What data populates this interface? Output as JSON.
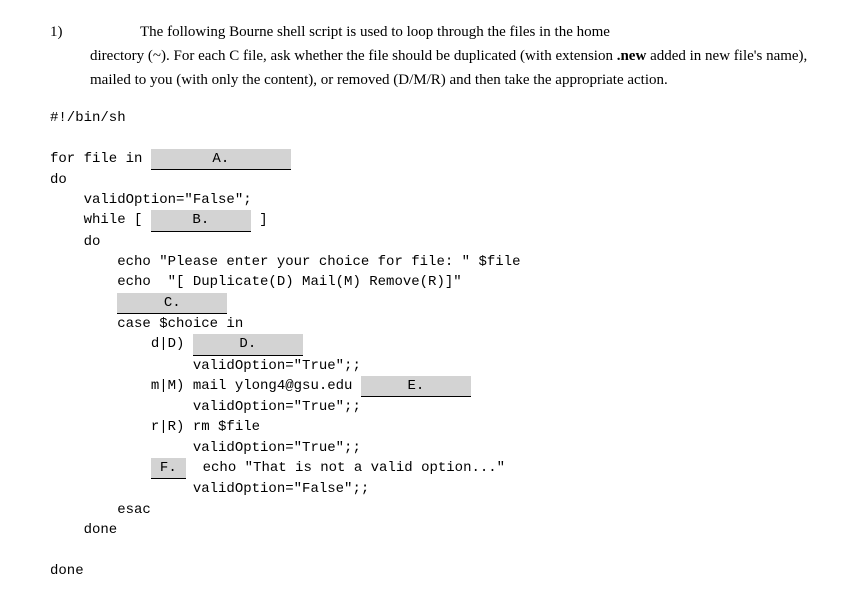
{
  "question": {
    "number": "1)",
    "intro_first": "The following Bourne shell script is used to loop through the files in the home",
    "intro_rest": "directory (~). For each C file, ask whether the file should be duplicated (with extension ",
    "intro_ext": ".new",
    "intro_rest2": " added in new file's name), mailed to you (with only the content), or removed (D/M/R) and then take the appropriate action."
  },
  "code": {
    "shebang": "#!/bin/sh",
    "for_line_pre": "for file in ",
    "do1": "do",
    "valid_opt": "    validOption=\"False\";",
    "while_pre": "    while [ ",
    "while_post": " ]",
    "do2": "    do",
    "echo1": "        echo \"Please enter your choice for file: \" $file",
    "echo2": "        echo  \"[ Duplicate(D) Mail(M) Remove(R)]\"",
    "blank_c_indent": "        ",
    "case_line": "        case $choice in",
    "case_d_pre": "            d|D) ",
    "case_d_valid": "                 validOption=\"True\";;",
    "case_m_pre": "            m|M) mail ylong4@gsu.edu ",
    "case_m_valid": "                 validOption=\"True\";;",
    "case_r": "            r|R) rm $file",
    "case_r_valid": "                 validOption=\"True\";;",
    "case_default_indent": "            ",
    "case_default_post": "  echo \"That is not a valid option...\"",
    "case_default_valid": "                 validOption=\"False\";;",
    "esac": "        esac",
    "done1": "    done",
    "done2": "done"
  },
  "blanks": {
    "a": "A.",
    "b": "B.",
    "c": "C.",
    "d": "D.",
    "e": "E.",
    "f": "F."
  }
}
